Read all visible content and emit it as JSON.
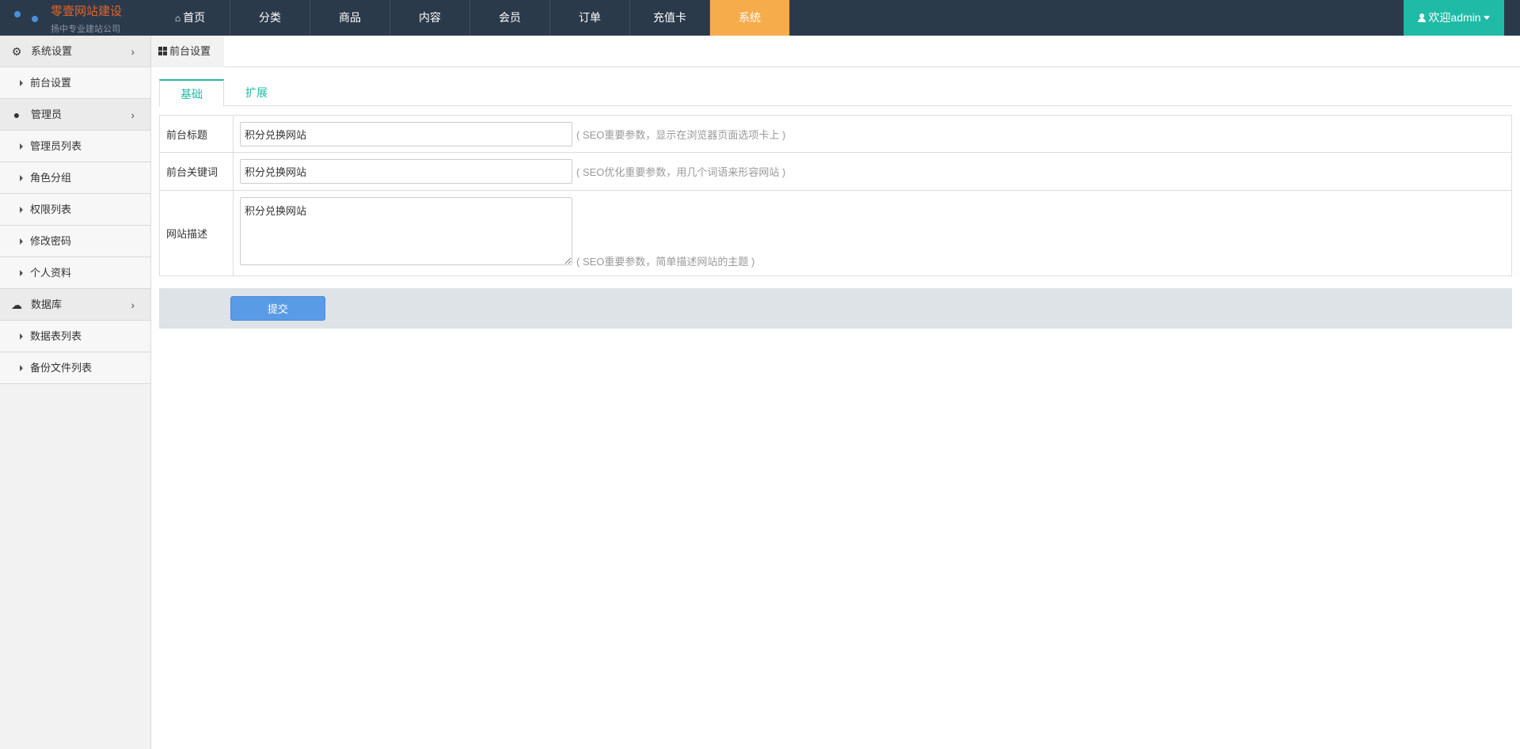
{
  "brand": {
    "title": "零壹网站建设",
    "subtitle": "扬中专业建站公司"
  },
  "topnav": {
    "items": [
      {
        "label": "首页",
        "icon": "home-icon",
        "active": false
      },
      {
        "label": "分类",
        "active": false
      },
      {
        "label": "商品",
        "active": false
      },
      {
        "label": "内容",
        "active": false
      },
      {
        "label": "会员",
        "active": false
      },
      {
        "label": "订单",
        "active": false
      },
      {
        "label": "充值卡",
        "active": false
      },
      {
        "label": "系统",
        "active": true
      }
    ],
    "active_color": "#f7ac4c",
    "user_label": "欢迎admin",
    "user_color": "#1fbba6"
  },
  "sidebar": {
    "groups": [
      {
        "label": "系统设置",
        "icon": "gears-icon",
        "items": [
          "前台设置"
        ]
      },
      {
        "label": "管理员",
        "icon": "person-icon",
        "items": [
          "管理员列表",
          "角色分组",
          "权限列表",
          "修改密码",
          "个人资料"
        ]
      },
      {
        "label": "数据库",
        "icon": "cloud-icon",
        "items": [
          "数据表列表",
          "备份文件列表"
        ]
      }
    ]
  },
  "page_tab": {
    "label": "前台设置"
  },
  "tabs": [
    {
      "label": "基础",
      "active": true
    },
    {
      "label": "扩展",
      "active": false
    }
  ],
  "form": {
    "rows": [
      {
        "label": "前台标题",
        "value": "积分兑换网站",
        "hint": "( SEO重要参数，显示在浏览器页面选项卡上 )"
      },
      {
        "label": "前台关键词",
        "value": "积分兑换网站",
        "hint": "( SEO优化重要参数，用几个词语来形容网站 )"
      },
      {
        "label": "网站描述",
        "value": "积分兑换网站",
        "hint": "( SEO重要参数，简单描述网站的主题 )"
      }
    ],
    "submit_label": "提交"
  }
}
